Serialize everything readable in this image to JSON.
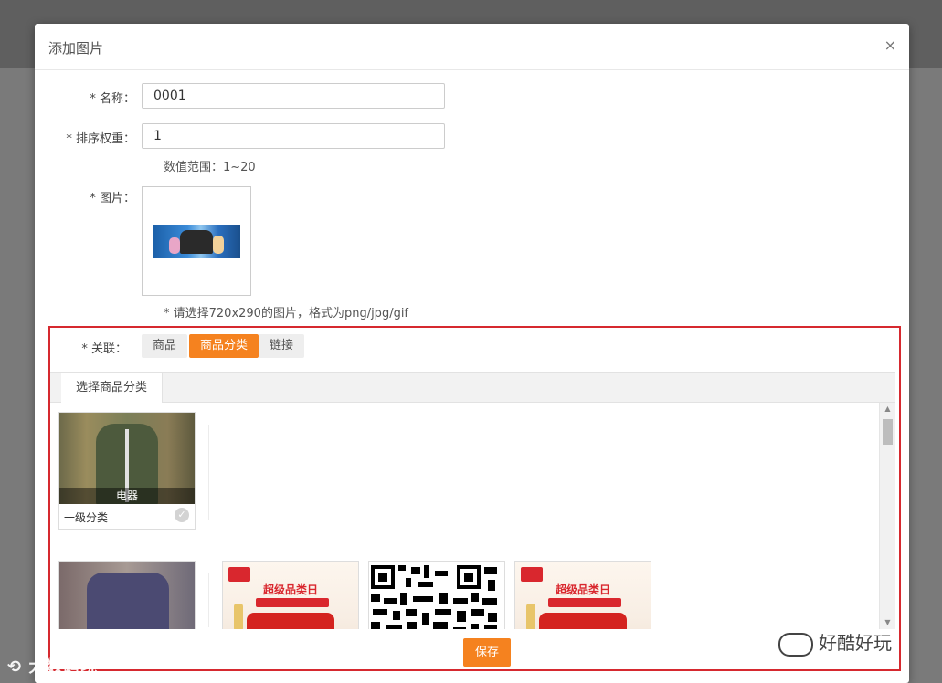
{
  "modal": {
    "title": "添加图片",
    "close": "×"
  },
  "form": {
    "name_label": "* 名称：",
    "name_value": "0001",
    "weight_label": "* 排序权重：",
    "weight_value": "1",
    "weight_hint": "数值范围：1~20",
    "image_label": "* 图片：",
    "image_hint": "* 请选择720x290的图片，格式为png/jpg/gif"
  },
  "relation": {
    "label": "* 关联：",
    "tabs": [
      {
        "label": "商品",
        "active": false
      },
      {
        "label": "商品分类",
        "active": true
      },
      {
        "label": "链接",
        "active": false
      }
    ],
    "sub_tab": "选择商品分类",
    "categories": [
      {
        "caption": "电器",
        "footer": "一级分类",
        "icon": "check-circle-icon"
      }
    ],
    "ad_titles": [
      "超级品类日",
      "超级品类日"
    ]
  },
  "actions": {
    "save": "保存"
  },
  "watermarks": {
    "left": "大数跨境",
    "right": "好酷好玩"
  },
  "colors": {
    "accent": "#f5821f",
    "highlight_border": "#d6292f"
  }
}
